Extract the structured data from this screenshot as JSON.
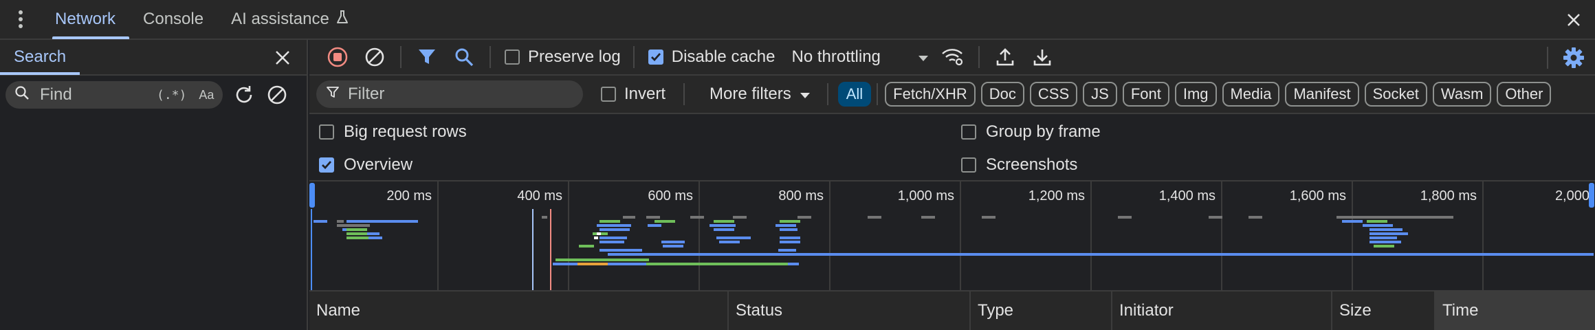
{
  "tabs": [
    {
      "label": "Network"
    },
    {
      "label": "Console"
    },
    {
      "label": "AI assistance"
    }
  ],
  "search": {
    "tab_label": "Search",
    "placeholder": "Find",
    "regex_label": "(.*)",
    "case_label": "Aa"
  },
  "toolbar": {
    "preserve_log": "Preserve log",
    "preserve_log_checked": false,
    "disable_cache": "Disable cache",
    "disable_cache_checked": true,
    "throttling": "No throttling"
  },
  "filter": {
    "placeholder": "Filter",
    "invert": "Invert",
    "more_filters": "More filters",
    "types": [
      "All",
      "Fetch/XHR",
      "Doc",
      "CSS",
      "JS",
      "Font",
      "Img",
      "Media",
      "Manifest",
      "Socket",
      "Wasm",
      "Other"
    ],
    "active_type": "All"
  },
  "settings": {
    "big_request_rows": "Big request rows",
    "group_by_frame": "Group by frame",
    "overview": "Overview",
    "screenshots": "Screenshots"
  },
  "overview": {
    "ticks": [
      "200 ms",
      "400 ms",
      "600 ms",
      "800 ms",
      "1,000 ms",
      "1,200 ms",
      "1,400 ms",
      "1,600 ms",
      "1,800 ms",
      "2,000"
    ]
  },
  "columns": [
    {
      "label": "Name"
    },
    {
      "label": "Status"
    },
    {
      "label": "Type"
    },
    {
      "label": "Initiator"
    },
    {
      "label": "Size"
    },
    {
      "label": "Time"
    }
  ],
  "colors": {
    "accent": "#a8c7fa",
    "checkbox": "#7cacf8",
    "record_stop": "#f28b82",
    "bar_blue": "#5b8def",
    "bar_green": "#6fbf5a",
    "bar_gray": "#757575"
  }
}
